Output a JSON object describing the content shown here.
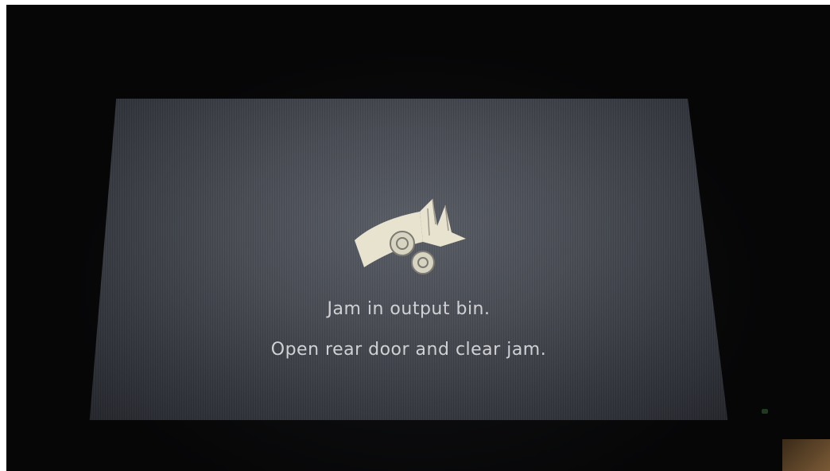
{
  "screen": {
    "icon": "paper-jam-output-bin-icon",
    "message_line_1": "Jam in output bin.",
    "message_line_2": "Open rear door and clear jam."
  },
  "colors": {
    "bezel": "#060607",
    "screen": "#4a4d55",
    "text": "#cfd1d4",
    "icon": "#e8e3cf"
  }
}
